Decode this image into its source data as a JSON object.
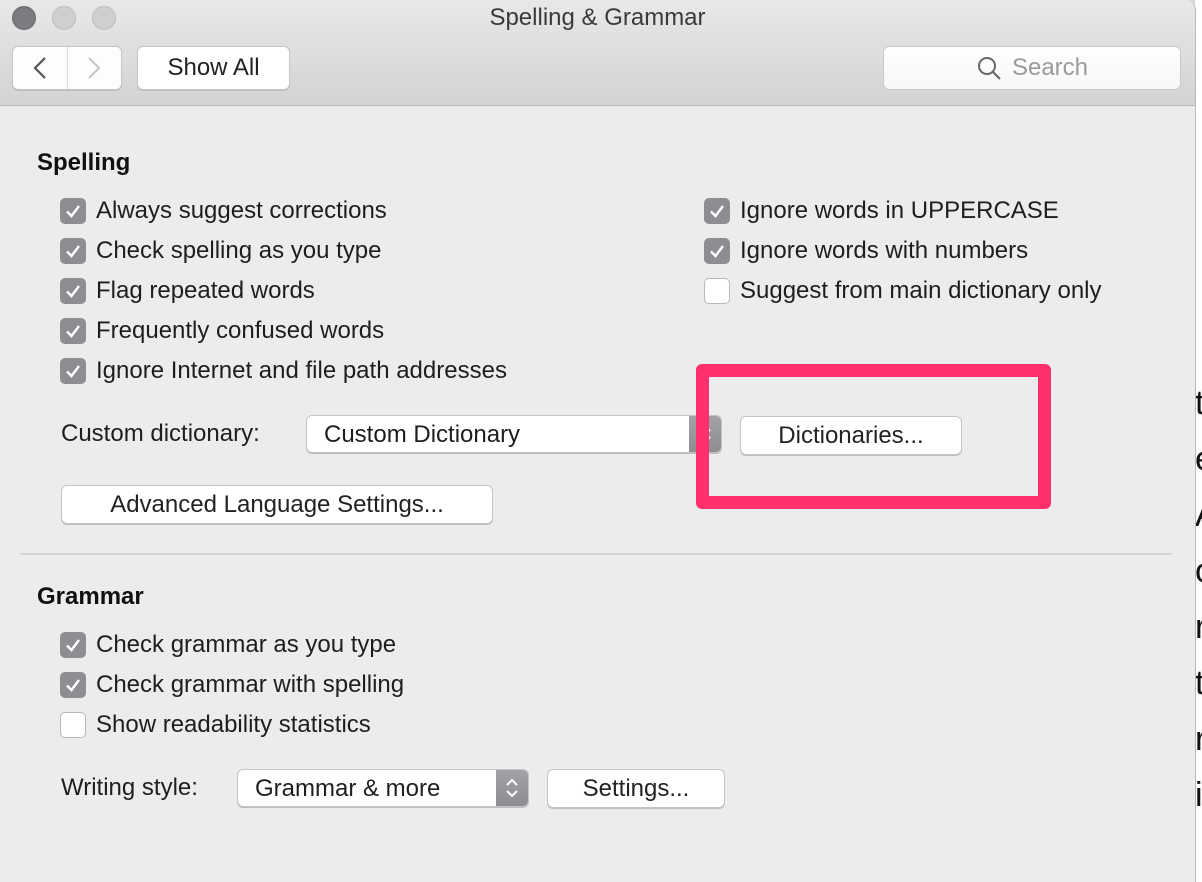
{
  "window": {
    "title": "Spelling & Grammar",
    "traffic_lights": [
      "close",
      "minimize",
      "zoom"
    ]
  },
  "toolbar": {
    "back_icon": "chevron-left-icon",
    "forward_icon": "chevron-right-icon",
    "show_all_label": "Show All",
    "search_placeholder": "Search",
    "search_icon": "magnifier-icon"
  },
  "spelling": {
    "title": "Spelling",
    "left_options": [
      {
        "label": "Always suggest corrections",
        "checked": true
      },
      {
        "label": "Check spelling as you type",
        "checked": true
      },
      {
        "label": "Flag repeated words",
        "checked": true
      },
      {
        "label": "Frequently confused words",
        "checked": true
      },
      {
        "label": "Ignore Internet and file path addresses",
        "checked": true
      }
    ],
    "right_options": [
      {
        "label": "Ignore words in UPPERCASE",
        "checked": true
      },
      {
        "label": "Ignore words with numbers",
        "checked": true
      },
      {
        "label": "Suggest from main dictionary only",
        "checked": false
      }
    ],
    "custom_dictionary_label": "Custom dictionary:",
    "custom_dictionary_value": "Custom Dictionary",
    "dictionaries_button": "Dictionaries...",
    "advanced_button": "Advanced Language Settings..."
  },
  "grammar": {
    "title": "Grammar",
    "options": [
      {
        "label": "Check grammar as you type",
        "checked": true
      },
      {
        "label": "Check grammar with spelling",
        "checked": true
      },
      {
        "label": "Show readability statistics",
        "checked": false
      }
    ],
    "writing_style_label": "Writing style:",
    "writing_style_value": "Grammar & more",
    "settings_button": "Settings..."
  },
  "annotation": {
    "color": "#ff2f6e",
    "target": "dictionaries-button"
  },
  "background_doc_glyphs": [
    "t",
    "e",
    "A",
    "o",
    "r",
    "t",
    "r",
    "i"
  ]
}
